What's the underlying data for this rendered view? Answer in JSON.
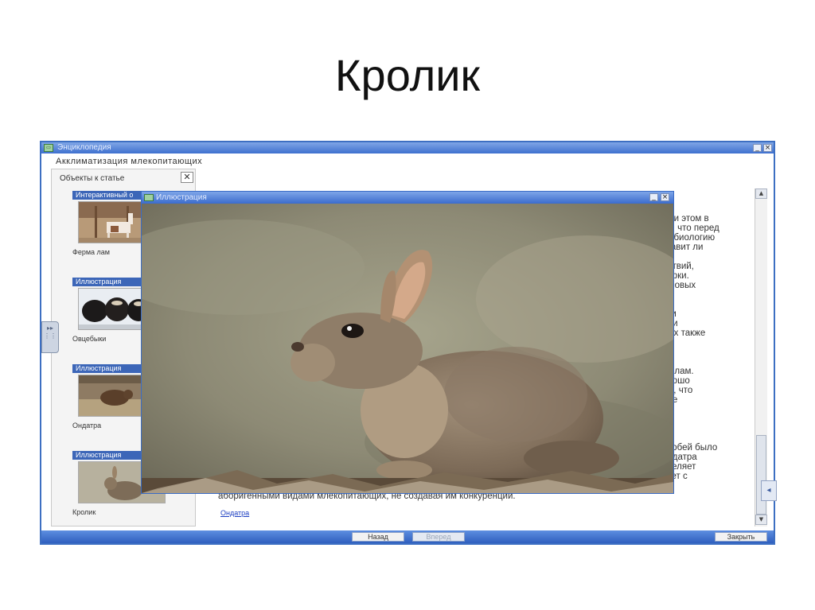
{
  "slide": {
    "title": "Кролик"
  },
  "window": {
    "title": "Энциклопедия",
    "article_heading": "Акклиматизация млекопитающих",
    "minimize_icon": "minimize-icon",
    "close_icon": "close-icon"
  },
  "left_panel": {
    "header": "Объекты к статье",
    "close_label": "✕",
    "cards": [
      {
        "label": "Интерактивный о",
        "caption": "Ферма лам"
      },
      {
        "label": "Иллюстрация",
        "caption": "Овцебыки"
      },
      {
        "label": "Иллюстрация",
        "caption": "Ондатра"
      },
      {
        "label": "Иллюстрация",
        "caption": "Кролик"
      }
    ]
  },
  "article_text": {
    "lines": [
      "При этом в",
      "но, что перед",
      "ть биологию",
      "ставит ли",
      "",
      "дствий,",
      "норки.",
      "в новых",
      "",
      "",
      "оки",
      "али",
      "рых также",
      "",
      "",
      "",
      "их лам.",
      "орошо",
      "ем, что",
      "ире",
      "",
      "",
      "",
      "",
      "особей было",
      "ондатра",
      "аселяет",
      "вует с"
    ],
    "bottom_line": "аборигенными видами млекопитающих, не создавая им конкуренции.",
    "link": "Ондатра"
  },
  "illustration_window": {
    "title": "Иллюстрация"
  },
  "bottom_bar": {
    "back": "Назад",
    "forward": "Вперед",
    "close": "Закрыть"
  },
  "colors": {
    "titlebar": "#3f70cf",
    "card_label": "#3c66b8",
    "link": "#1c3ec2"
  }
}
